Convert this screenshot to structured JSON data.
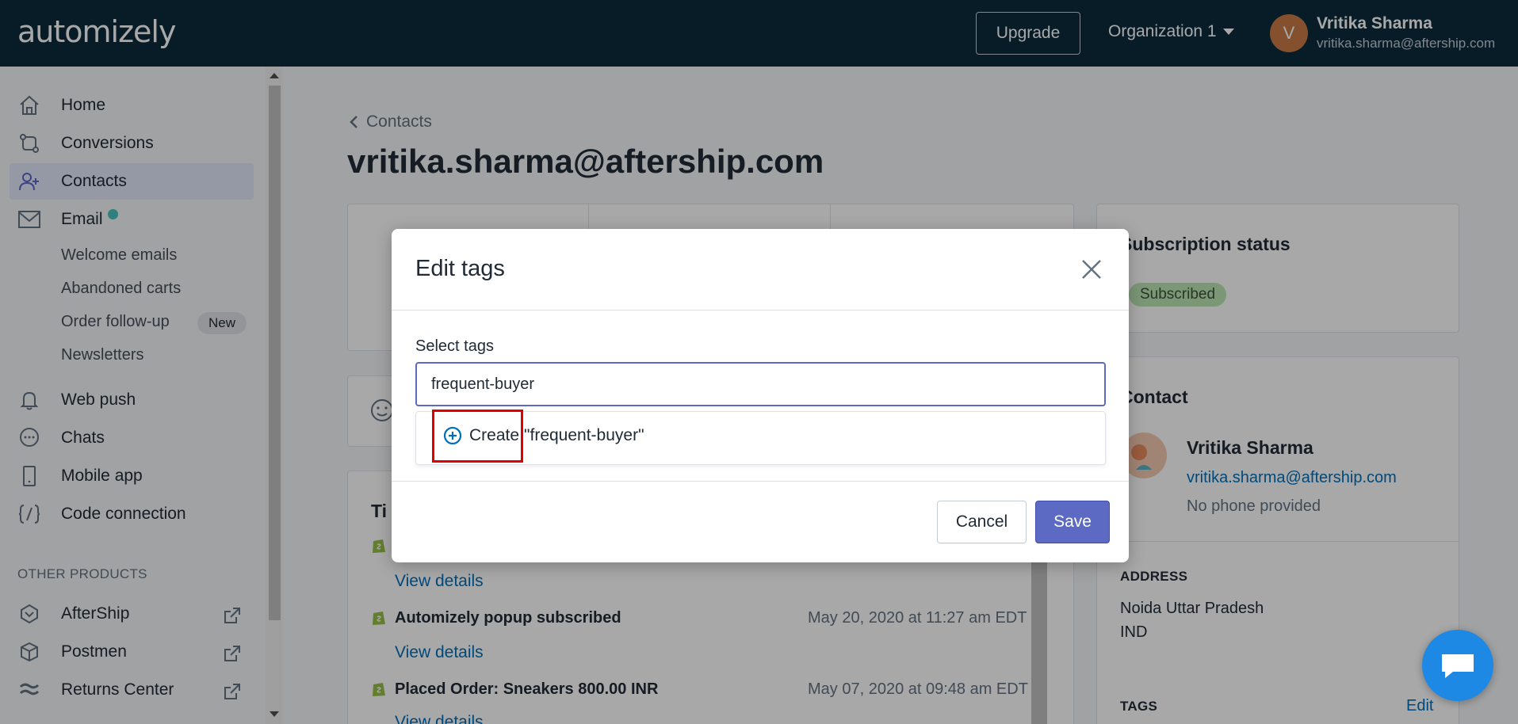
{
  "topbar": {
    "logo": "automizely",
    "upgrade_label": "Upgrade",
    "org_label": "Organization 1",
    "avatar_initial": "V",
    "user_name": "Vritika Sharma",
    "user_email": "vritika.sharma@aftership.com"
  },
  "sidebar": {
    "items": [
      {
        "label": "Home",
        "icon": "home-icon"
      },
      {
        "label": "Conversions",
        "icon": "conversions-icon"
      },
      {
        "label": "Contacts",
        "icon": "contacts-icon",
        "active": true
      },
      {
        "label": "Email",
        "icon": "email-icon"
      },
      {
        "label": "Web push",
        "icon": "bell-icon"
      },
      {
        "label": "Chats",
        "icon": "chat-icon"
      },
      {
        "label": "Mobile app",
        "icon": "mobile-icon"
      },
      {
        "label": "Code connection",
        "icon": "code-icon"
      }
    ],
    "email_sub": [
      "Welcome emails",
      "Abandoned carts",
      "Order follow-up",
      "Newsletters"
    ],
    "new_badge": "New",
    "other_products_label": "OTHER PRODUCTS",
    "other_products": [
      {
        "label": "AfterShip",
        "icon": "aftership-icon"
      },
      {
        "label": "Postmen",
        "icon": "postmen-icon"
      },
      {
        "label": "Returns Center",
        "icon": "returns-icon"
      }
    ]
  },
  "main": {
    "back_label": "Contacts",
    "title": "vritika.sharma@aftership.com",
    "subscription": {
      "title": "Subscription status",
      "status": "Subscribed"
    },
    "contact": {
      "title": "Contact",
      "name": "Vritika Sharma",
      "email": "vritika.sharma@aftership.com",
      "phone": "No phone provided",
      "address_label": "ADDRESS",
      "address_line1": "Noida Uttar Pradesh",
      "address_line2": "IND",
      "tags_label": "TAGS",
      "edit_label": "Edit"
    },
    "timeline": {
      "title_fragment": "Ti",
      "view_details": "View details",
      "rows": [
        {
          "title": "Automizely popup subscribed",
          "date": "May 20, 2020 at 11:27 am EDT"
        },
        {
          "title": "Placed Order: Sneakers 800.00 INR",
          "date": "May 07, 2020 at 09:48 am EDT"
        }
      ]
    }
  },
  "modal": {
    "title": "Edit tags",
    "field_label": "Select tags",
    "input_value": "frequent-buyer",
    "create_prefix": "Create",
    "create_value": "\"frequent-buyer\"",
    "cancel_label": "Cancel",
    "save_label": "Save"
  },
  "colors": {
    "topbar": "#0d2b3e",
    "primary": "#5c6ac4",
    "link": "#006fbb",
    "highlight": "#e00000"
  }
}
